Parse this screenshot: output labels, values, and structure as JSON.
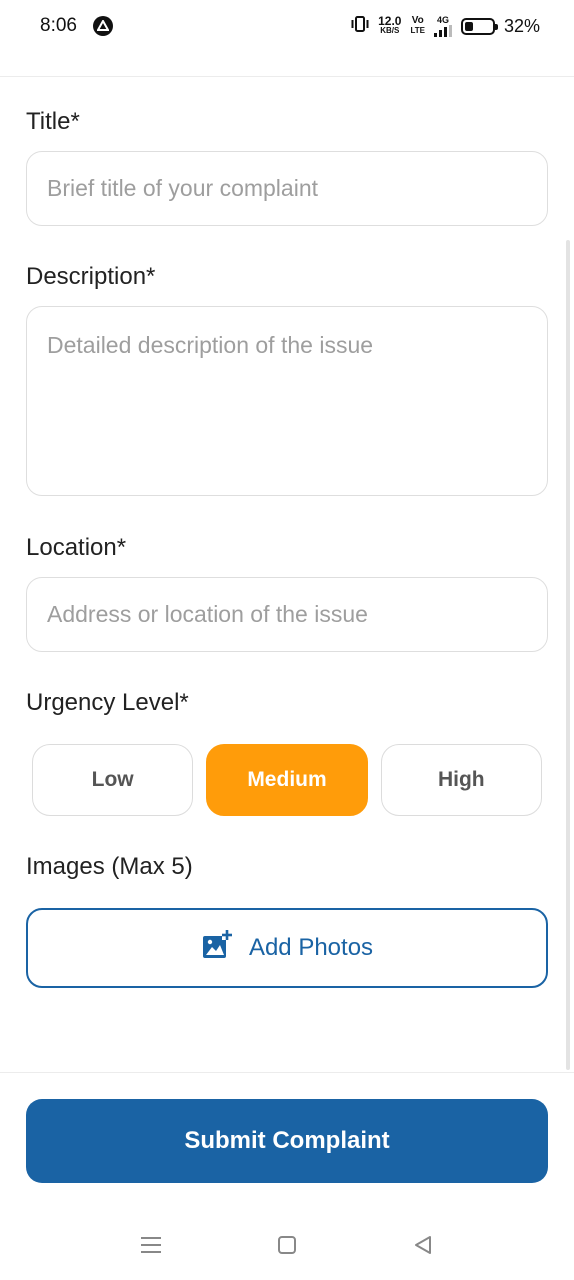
{
  "status_bar": {
    "time": "8:06",
    "data_speed_value": "12.0",
    "data_speed_unit": "KB/S",
    "volte_top": "Vo",
    "volte_bottom": "LTE",
    "network": "4G",
    "battery_percent": "32%",
    "battery_level": 0.32
  },
  "form": {
    "title": {
      "label": "Title*",
      "value": "",
      "placeholder": "Brief title of your complaint"
    },
    "description": {
      "label": "Description*",
      "value": "",
      "placeholder": "Detailed description of the issue"
    },
    "location": {
      "label": "Location*",
      "value": "",
      "placeholder": "Address or location of the issue"
    },
    "urgency": {
      "label": "Urgency Level*",
      "options": [
        "Low",
        "Medium",
        "High"
      ],
      "selected": "Medium"
    },
    "images": {
      "label": "Images (Max 5)",
      "add_button_label": "Add Photos",
      "add_icon": "add-photo-icon"
    },
    "submit_label": "Submit Complaint"
  },
  "colors": {
    "primary": "#1a63a4",
    "accent": "#ff9c0a"
  },
  "nav_bar": {
    "icons": [
      "menu-icon",
      "home-square-icon",
      "back-triangle-icon"
    ]
  }
}
